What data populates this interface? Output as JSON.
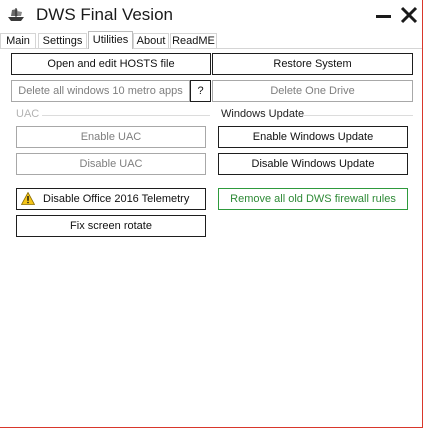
{
  "window": {
    "title": "DWS Final Vesion"
  },
  "icons": {
    "app": "pirate-ship-icon",
    "minimize": "minimize-icon",
    "close": "close-icon",
    "warning": "warning-icon"
  },
  "tabs": [
    {
      "label": "Main",
      "active": false
    },
    {
      "label": "Settings",
      "active": false
    },
    {
      "label": "Utilities",
      "active": true
    },
    {
      "label": "About",
      "active": false
    },
    {
      "label": "ReadME",
      "active": false
    }
  ],
  "utilities": {
    "hosts_button": "Open and edit HOSTS file",
    "restore_button": "Restore System",
    "delete_metro_button": "Delete all windows 10 metro apps",
    "help_button": "?",
    "delete_onedrive_button": "Delete One Drive",
    "uac": {
      "label": "UAC",
      "enable_button": "Enable UAC",
      "disable_button": "Disable UAC"
    },
    "windows_update": {
      "label": "Windows Update",
      "enable_button": "Enable Windows Update",
      "disable_button": "Disable Windows Update"
    },
    "office_telemetry_button": "Disable Office 2016 Telemetry",
    "firewall_button": "Remove all old DWS firewall rules",
    "screen_rotate_button": "Fix screen rotate"
  },
  "colors": {
    "window_border": "#d9372b",
    "green_accent": "#2e9a3c",
    "warning_yellow": "#f5c518"
  }
}
